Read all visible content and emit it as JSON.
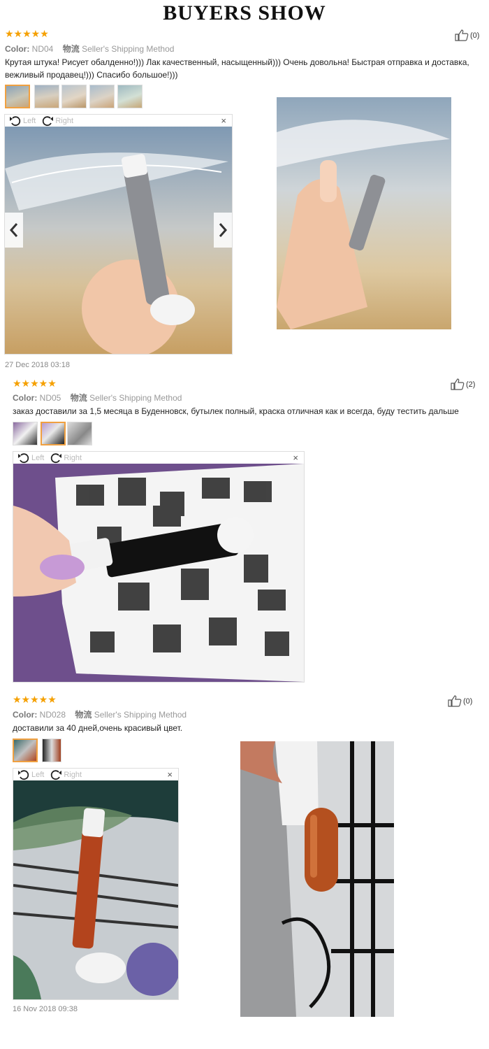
{
  "title": "BUYERS SHOW",
  "colors": {
    "star": "#f5a000",
    "accent": "#f0a040"
  },
  "labels": {
    "left": "Left",
    "right": "Right",
    "close": "×"
  },
  "reviews": [
    {
      "rating": 5,
      "stars": "★★★★★",
      "color_label": "Color:",
      "color_value": "ND04",
      "shipping_label": "物流",
      "shipping_value": "Seller's Shipping Method",
      "likes": "(0)",
      "text": "Крутая штука! Рисует обалденно!))) Лак качественный, насыщенный))) Очень довольна! Быстрая отправка и доставка, вежливый продавец!))) Спасибо большое!)))",
      "date": "27 Dec 2018 03:18",
      "thumbs": 5
    },
    {
      "rating": 5,
      "stars": "★★★★★",
      "color_label": "Color:",
      "color_value": "ND05",
      "shipping_label": "物流",
      "shipping_value": "Seller's Shipping Method",
      "likes": "(2)",
      "text": "заказ доставили за 1,5 месяца в Буденновск, бутылек полный, краска отличная как и всегда, буду тестить дальше",
      "thumbs": 3
    },
    {
      "rating": 5,
      "stars": "★★★★★",
      "color_label": "Color:",
      "color_value": "ND028",
      "shipping_label": "物流",
      "shipping_value": "Seller's Shipping Method",
      "likes": "(0)",
      "text": "доставили за 40 дней,очень красивый цвет.",
      "date": "16 Nov 2018 09:38",
      "thumbs": 2
    }
  ],
  "icons": [
    "thumbs-up-icon",
    "rotate-left-icon",
    "rotate-right-icon",
    "close-icon",
    "chevron-left-icon",
    "chevron-right-icon"
  ]
}
